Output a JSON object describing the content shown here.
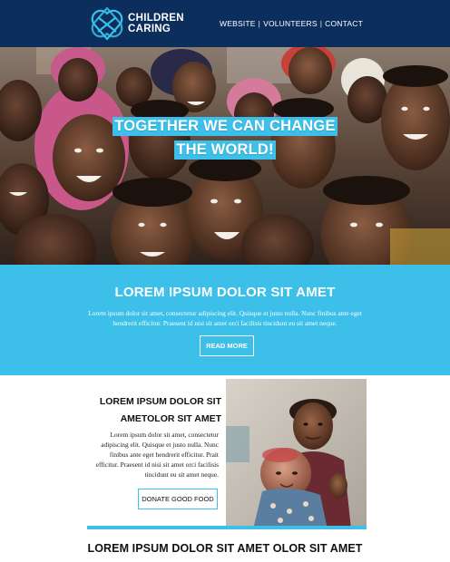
{
  "header": {
    "logo_icon": "heart-knot-logo-icon",
    "logo_line1": "CHILDREN",
    "logo_line2": "CARING",
    "nav": [
      {
        "label": "WEBSITE"
      },
      {
        "label": "VOLUNTEERS"
      },
      {
        "label": "CONTACT"
      }
    ],
    "nav_separator": "|"
  },
  "hero": {
    "image": "smiling-children-group-photo",
    "title_line1": "TOGETHER WE CAN CHANGE",
    "title_line2": "THE WORLD!"
  },
  "band": {
    "title": "LOREM IPSUM DOLOR SIT AMET",
    "body": "Lorem ipsum dolor sit amet, consectetur adipiscing elit. Quisque et justo nulla. Nunc finibus ante eget hendrerit efficitur. Praesent id nisi sit amet orci facilisis tincidunt eu sit amet neque.",
    "button_label": "READ MORE"
  },
  "feature": {
    "title_line1": "LOREM IPSUM DOLOR SIT",
    "title_line2": "AMETOLOR SIT AMET",
    "body": "Lorem ipsum dolor sit amet, consectetur adipiscing elit. Quisque et justo nulla. Nunc finibus ante eget hendrerit efficitur. Prait efficitur. Praesent id nisi sit amet orci facilisis tincidunt eu sit amet neque.",
    "button_label": "DONATE GOOD FOOD",
    "image": "girl-holding-baby-photo"
  },
  "bottom": {
    "title": "LOREM IPSUM DOLOR SIT AMET OLOR SIT AMET"
  },
  "colors": {
    "header_bg": "#0b2e5c",
    "accent": "#3cbfe8",
    "text_dark": "#111111"
  }
}
